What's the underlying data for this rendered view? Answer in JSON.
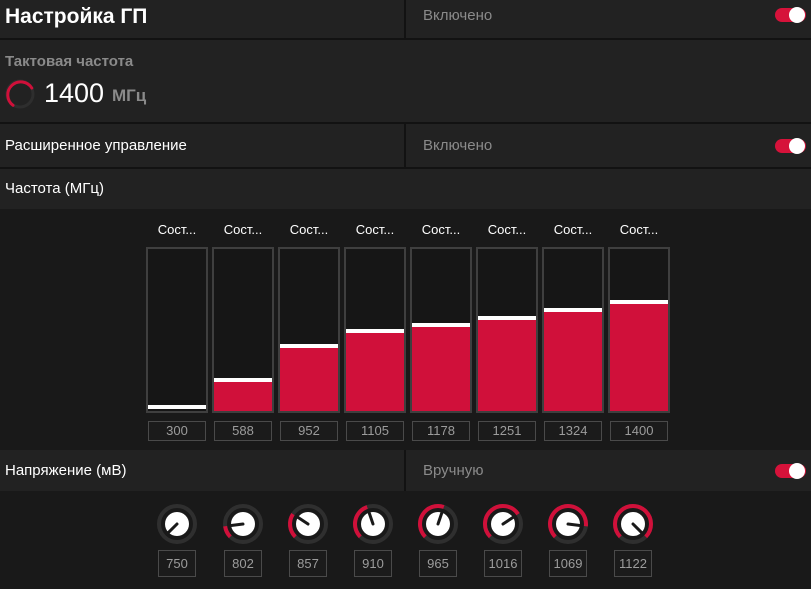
{
  "title": "Настройка ГП",
  "gpu_tuning_status": "Включено",
  "clock": {
    "label": "Тактовая частота",
    "value": "1400",
    "unit": "МГц"
  },
  "advanced": {
    "label": "Расширенное управление",
    "status": "Включено"
  },
  "frequency_header": "Частота (МГц)",
  "states": [
    {
      "label": "Сост...",
      "freq": "300",
      "fill": 0.0
    },
    {
      "label": "Сост...",
      "freq": "588",
      "fill": 0.18
    },
    {
      "label": "Сост...",
      "freq": "952",
      "fill": 0.39
    },
    {
      "label": "Сост...",
      "freq": "1105",
      "fill": 0.48
    },
    {
      "label": "Сост...",
      "freq": "1178",
      "fill": 0.52
    },
    {
      "label": "Сост...",
      "freq": "1251",
      "fill": 0.56
    },
    {
      "label": "Сост...",
      "freq": "1324",
      "fill": 0.61
    },
    {
      "label": "Сост...",
      "freq": "1400",
      "fill": 0.66
    }
  ],
  "voltage": {
    "label": "Напряжение (мВ)",
    "mode": "Вручную",
    "values": [
      "750",
      "802",
      "857",
      "910",
      "965",
      "1016",
      "1069",
      "1122"
    ],
    "levels": [
      0.0,
      0.14,
      0.29,
      0.43,
      0.57,
      0.71,
      0.86,
      1.0
    ]
  },
  "colors": {
    "accent": "#d0103a",
    "toggle": "#d6123a"
  }
}
